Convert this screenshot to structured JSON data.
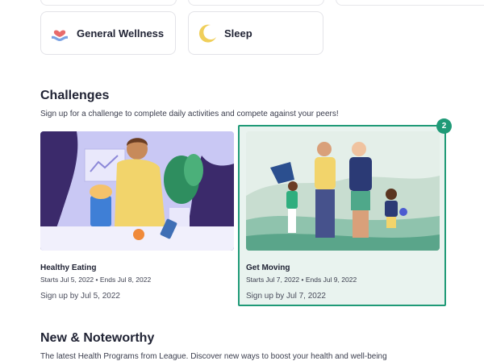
{
  "categories": [
    {
      "label": "General Wellness",
      "icon": "wellness-icon"
    },
    {
      "label": "Sleep",
      "icon": "moon-icon"
    }
  ],
  "challenges_section": {
    "title": "Challenges",
    "subtitle": "Sign up for a challenge to complete daily activities and compete against your peers!"
  },
  "challenges": [
    {
      "title": "Healthy Eating",
      "dates": "Starts Jul 5, 2022 • Ends Jul 8, 2022",
      "signup": "Sign up by Jul 5, 2022",
      "image": "healthy-eating-illustration"
    },
    {
      "title": "Get Moving",
      "dates": "Starts Jul 7, 2022 • Ends Jul 9, 2022",
      "signup": "Sign up by Jul 7, 2022",
      "image": "get-moving-illustration"
    }
  ],
  "highlight_badge": "2",
  "new_section": {
    "title": "New & Noteworthy",
    "subtitle": "The latest Health Programs from League. Discover new ways to boost your health and well-being"
  },
  "colors": {
    "highlight": "#1f9a77",
    "text": "#1f2233",
    "eating_bg": "#c9c8f4",
    "moving_bg": "#dcebe4"
  }
}
